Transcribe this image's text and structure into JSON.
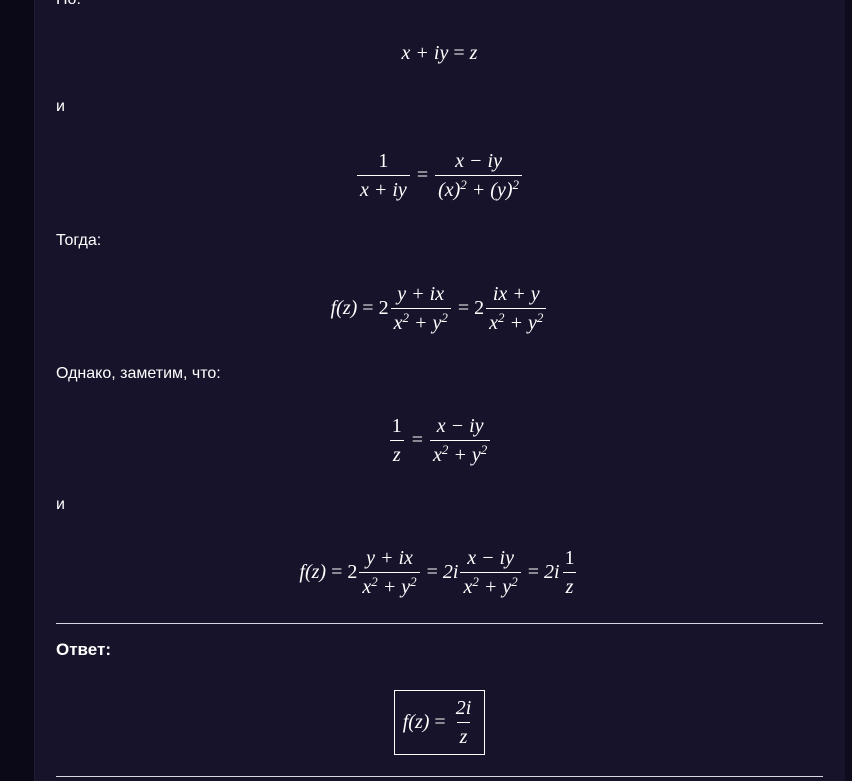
{
  "text": {
    "top_fragment": "Но:",
    "and_1": "и",
    "then": "Тогда:",
    "however": "Однако, заметим, что:",
    "and_2": "и",
    "answer_label": "Ответ:"
  },
  "eq1": {
    "lhs": "x + iy",
    "eq": "=",
    "rhs": "z"
  },
  "eq2": {
    "num_l": "1",
    "den_l": "x + iy",
    "eq": "=",
    "num_r": "x − iy",
    "den_r_a": "(x)",
    "den_r_b": "+ (y)",
    "exp": "2"
  },
  "eq3": {
    "f": "f",
    "arg": "(z)",
    "eq": "=",
    "coef": "2",
    "num1": "y + ix",
    "den_x": "x",
    "den_plus": "+ y",
    "exp": "2",
    "eq2": "=",
    "coef2": "2",
    "num2": "ix + y"
  },
  "eq4": {
    "num_l": "1",
    "den_l": "z",
    "eq": "=",
    "num_r": "x − iy",
    "den_x": "x",
    "den_plus": "+ y",
    "exp": "2"
  },
  "eq5": {
    "f": "f",
    "arg": "(z)",
    "eq": "=",
    "coef": "2",
    "num1": "y + ix",
    "den_x": "x",
    "den_plus": "+ y",
    "exp": "2",
    "coef2": "2i",
    "num2": "x − iy",
    "coef3": "2i",
    "num3": "1",
    "den3": "z"
  },
  "answer": {
    "f": "f",
    "arg": "(z)",
    "eq": "=",
    "num": "2i",
    "den": "z"
  },
  "colors": {
    "background": "#16132a",
    "text": "#ffffff",
    "rule": "#d8d6e4"
  }
}
